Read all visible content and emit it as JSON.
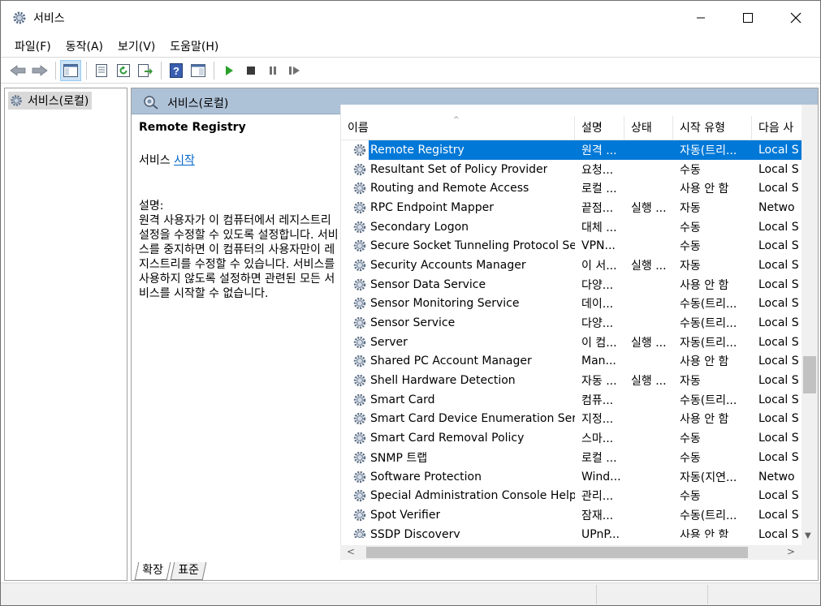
{
  "window": {
    "title": "서비스"
  },
  "menu": [
    {
      "label": "파일(F)"
    },
    {
      "label": "동작(A)"
    },
    {
      "label": "보기(V)"
    },
    {
      "label": "도움말(H)"
    }
  ],
  "toolbar": {
    "icons": [
      "back-arrow-icon",
      "forward-arrow-icon",
      "console-tree-icon",
      "properties-icon",
      "refresh-icon",
      "export-list-icon",
      "help-icon",
      "view-icon",
      "play-icon",
      "stop-icon",
      "pause-icon",
      "resume-icon"
    ]
  },
  "tree": {
    "root_label": "서비스(로컬)"
  },
  "pane": {
    "header_title": "서비스(로컬)"
  },
  "details": {
    "service_name": "Remote Registry",
    "start_prefix": "서비스",
    "start_link": "시작",
    "desc_label": "설명:",
    "desc_text": "원격 사용자가 이 컴퓨터에서 레지스트리 설정을 수정할 수 있도록 설정합니다. 서비스를 중지하면 이 컴퓨터의 사용자만이 레지스트리를 수정할 수 있습니다. 서비스를 사용하지 않도록 설정하면 관련된 모든 서비스를 시작할 수 없습니다."
  },
  "columns": {
    "name": "이름",
    "description": "설명",
    "status": "상태",
    "startup": "시작 유형",
    "logon": "다음 사"
  },
  "services": [
    {
      "name": "Remote Registry",
      "desc": "원격 ...",
      "status": "",
      "startup": "자동(트리...",
      "logon": "Local S",
      "selected": true
    },
    {
      "name": "Resultant Set of Policy Provider",
      "desc": "요청...",
      "status": "",
      "startup": "수동",
      "logon": "Local S"
    },
    {
      "name": "Routing and Remote Access",
      "desc": "로컬 ...",
      "status": "",
      "startup": "사용 안 함",
      "logon": "Local S"
    },
    {
      "name": "RPC Endpoint Mapper",
      "desc": "끝점...",
      "status": "실행 ...",
      "startup": "자동",
      "logon": "Netwo"
    },
    {
      "name": "Secondary Logon",
      "desc": "대체 ...",
      "status": "",
      "startup": "수동",
      "logon": "Local S"
    },
    {
      "name": "Secure Socket Tunneling Protocol Ser...",
      "desc": "VPN...",
      "status": "",
      "startup": "수동",
      "logon": "Local S"
    },
    {
      "name": "Security Accounts Manager",
      "desc": "이 서...",
      "status": "실행 ...",
      "startup": "자동",
      "logon": "Local S"
    },
    {
      "name": "Sensor Data Service",
      "desc": "다양...",
      "status": "",
      "startup": "사용 안 함",
      "logon": "Local S"
    },
    {
      "name": "Sensor Monitoring Service",
      "desc": "데이...",
      "status": "",
      "startup": "수동(트리...",
      "logon": "Local S"
    },
    {
      "name": "Sensor Service",
      "desc": "다양...",
      "status": "",
      "startup": "수동(트리...",
      "logon": "Local S"
    },
    {
      "name": "Server",
      "desc": "이 컴...",
      "status": "실행 ...",
      "startup": "자동(트리...",
      "logon": "Local S"
    },
    {
      "name": "Shared PC Account Manager",
      "desc": "Man...",
      "status": "",
      "startup": "사용 안 함",
      "logon": "Local S"
    },
    {
      "name": "Shell Hardware Detection",
      "desc": "자동 ...",
      "status": "실행 ...",
      "startup": "자동",
      "logon": "Local S"
    },
    {
      "name": "Smart Card",
      "desc": "컴퓨...",
      "status": "",
      "startup": "수동(트리...",
      "logon": "Local S"
    },
    {
      "name": "Smart Card Device Enumeration Servi...",
      "desc": "지정...",
      "status": "",
      "startup": "사용 안 함",
      "logon": "Local S"
    },
    {
      "name": "Smart Card Removal Policy",
      "desc": "스마...",
      "status": "",
      "startup": "수동",
      "logon": "Local S"
    },
    {
      "name": "SNMP 트랩",
      "desc": "로컬 ...",
      "status": "",
      "startup": "수동",
      "logon": "Local S"
    },
    {
      "name": "Software Protection",
      "desc": "Wind...",
      "status": "",
      "startup": "자동(지연...",
      "logon": "Netwo"
    },
    {
      "name": "Special Administration Console Helper",
      "desc": "관리...",
      "status": "",
      "startup": "수동",
      "logon": "Local S"
    },
    {
      "name": "Spot Verifier",
      "desc": "잠재...",
      "status": "",
      "startup": "수동(트리...",
      "logon": "Local S"
    },
    {
      "name": "SSDP Discovery",
      "desc": "UPnP...",
      "status": "",
      "startup": "사용 안 함",
      "logon": "Local S"
    }
  ],
  "tabs": [
    {
      "label": "확장"
    },
    {
      "label": "표준"
    }
  ],
  "colors": {
    "selection": "#0078d7",
    "pane_header": "#aec2d7",
    "link": "#0066cc"
  }
}
